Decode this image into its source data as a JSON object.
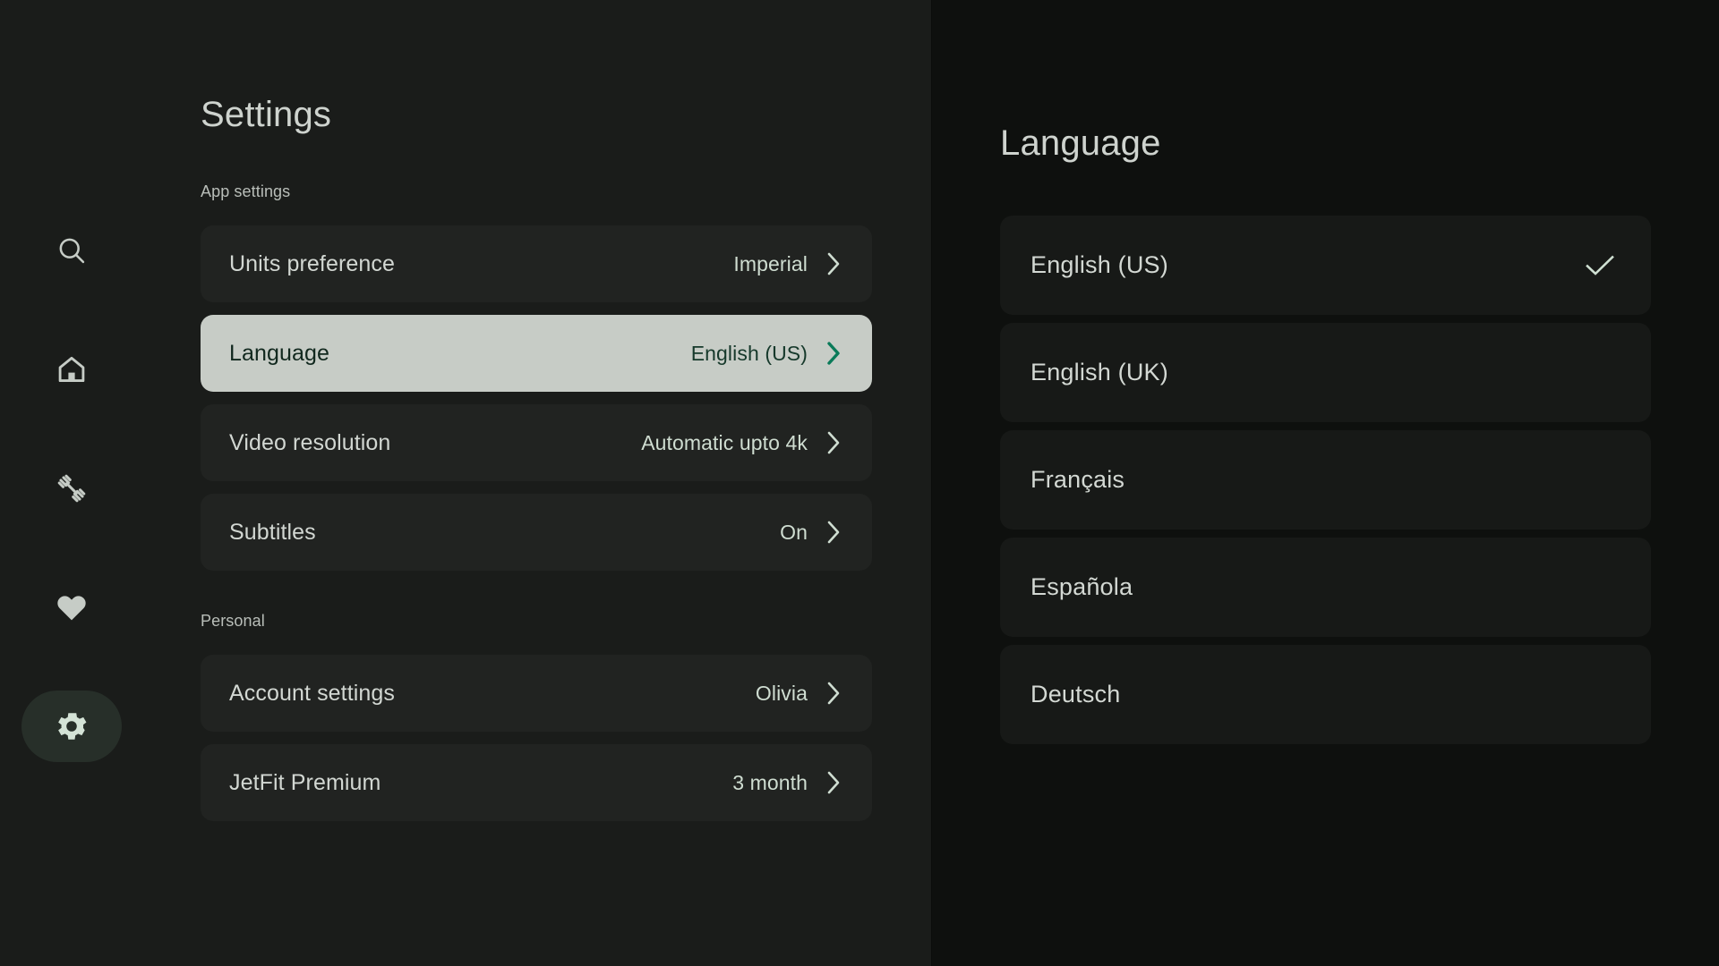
{
  "nav": {
    "items": [
      {
        "icon": "search-icon",
        "name": "search",
        "active": false
      },
      {
        "icon": "home-icon",
        "name": "home",
        "active": false
      },
      {
        "icon": "dumbbell-icon",
        "name": "workouts",
        "active": false
      },
      {
        "icon": "heart-icon",
        "name": "favorites",
        "active": false
      },
      {
        "icon": "gear-icon",
        "name": "settings",
        "active": true
      }
    ]
  },
  "settings": {
    "title": "Settings",
    "sections": [
      {
        "label": "App settings",
        "rows": [
          {
            "label": "Units preference",
            "value": "Imperial",
            "selected": false
          },
          {
            "label": "Language",
            "value": "English (US)",
            "selected": true
          },
          {
            "label": "Video resolution",
            "value": "Automatic upto 4k",
            "selected": false
          },
          {
            "label": "Subtitles",
            "value": "On",
            "selected": false
          }
        ]
      },
      {
        "label": "Personal",
        "rows": [
          {
            "label": "Account settings",
            "value": "Olivia",
            "selected": false
          },
          {
            "label": "JetFit Premium",
            "value": "3 month",
            "selected": false
          }
        ]
      }
    ]
  },
  "language": {
    "title": "Language",
    "options": [
      {
        "label": "English (US)",
        "checked": true
      },
      {
        "label": "English (UK)",
        "checked": false
      },
      {
        "label": "Français",
        "checked": false
      },
      {
        "label": "Española",
        "checked": false
      },
      {
        "label": "Deutsch",
        "checked": false
      }
    ]
  },
  "colors": {
    "page_bg": "#1a1c1a",
    "panel_bg": "#0e100e",
    "card_bg": "#212321",
    "card_bg_right": "#171917",
    "selected_bg": "#c7ccc6",
    "accent_mint": "#cfddd1",
    "accent_teal": "#0a7a59",
    "text_primary": "#d2d7d2",
    "nav_active_pill": "#272f29"
  }
}
